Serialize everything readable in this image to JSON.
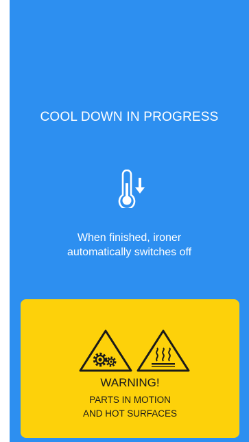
{
  "screen": {
    "background_color": "#2d8ff0",
    "title": "COOL DOWN IN PROGRESS",
    "status_icon": "thermometer-down-icon",
    "message_line_1": "When finished, ironer",
    "message_line_2": "automatically switches off"
  },
  "warning": {
    "background_color": "#fdd10a",
    "icons": [
      "moving-parts-warning-icon",
      "hot-surface-warning-icon"
    ],
    "title": "WARNING!",
    "detail_line_1": "PARTS IN MOTION",
    "detail_line_2": "AND HOT SURFACES"
  }
}
